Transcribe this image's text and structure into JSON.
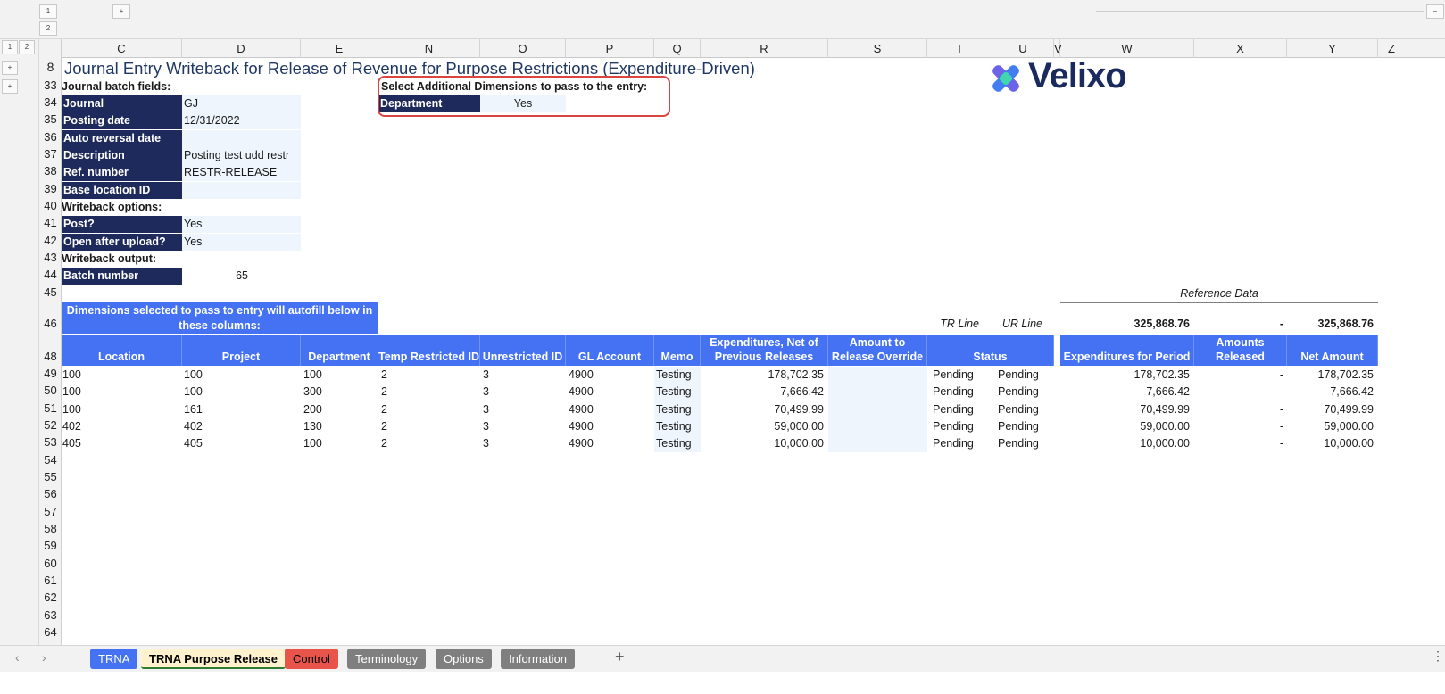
{
  "outline": {
    "levels_top": [
      "1",
      "2"
    ],
    "levels_side": [
      "1",
      "2"
    ],
    "expand": "+",
    "collapse": "−"
  },
  "columns": [
    "C",
    "D",
    "E",
    "N",
    "O",
    "P",
    "Q",
    "R",
    "S",
    "T",
    "U",
    "V",
    "W",
    "X",
    "Y",
    "Z"
  ],
  "rows": [
    "8",
    "33",
    "34",
    "35",
    "36",
    "37",
    "38",
    "39",
    "40",
    "41",
    "42",
    "43",
    "44",
    "45",
    "46",
    "48",
    "49",
    "50",
    "51",
    "52",
    "53",
    "54",
    "55",
    "56",
    "57",
    "58",
    "59",
    "60",
    "61",
    "62",
    "63",
    "64"
  ],
  "title": "Journal Entry Writeback for Release of Revenue for Purpose Restrictions (Expenditure-Driven)",
  "logo_text": "Velixo",
  "batch": {
    "header": "Journal batch fields:",
    "fields": [
      {
        "label": "Journal",
        "value": "GJ"
      },
      {
        "label": "Posting date",
        "value": "12/31/2022"
      },
      {
        "label": "Auto reversal date",
        "value": ""
      },
      {
        "label": "Description",
        "value": "Posting test udd restr"
      },
      {
        "label": "Ref. number",
        "value": "RESTR-RELEASE"
      },
      {
        "label": "Base location ID",
        "value": ""
      }
    ]
  },
  "writeback_options": {
    "header": "Writeback options:",
    "fields": [
      {
        "label": "Post?",
        "value": "Yes"
      },
      {
        "label": "Open after upload?",
        "value": "Yes"
      }
    ]
  },
  "writeback_output": {
    "header": "Writeback output:",
    "label": "Batch number",
    "value": "65"
  },
  "dimensions": {
    "header": "Select Additional Dimensions to pass to the entry:",
    "label": "Department",
    "value": "Yes"
  },
  "dim_note": "Dimensions selected to pass to entry will autofill below in these columns:",
  "reference_data": "Reference Data",
  "tr_line": "TR Line",
  "ur_line": "UR Line",
  "totals": {
    "expenditures": "325,868.76",
    "released": "-",
    "net": "325,868.76"
  },
  "table_headers": {
    "location": "Location",
    "project": "Project",
    "department": "Department",
    "temp_restricted": "Temp Restricted ID",
    "unrestricted": "Unrestricted ID",
    "gl_account": "GL Account",
    "memo": "Memo",
    "expenditures_net": "Expenditures, Net of Previous Releases",
    "override": "Amount to Release Override",
    "status": "Status",
    "exp_period": "Expenditures for Period",
    "amounts_released": "Amounts Released",
    "net_amount": "Net Amount"
  },
  "table_rows": [
    {
      "location": "100",
      "project": "100",
      "department": "100",
      "temp": "2",
      "unres": "3",
      "gl": "4900",
      "memo": "Testing",
      "exp_net": "178,702.35",
      "tr": "Pending",
      "ur": "Pending",
      "exp_period": "178,702.35",
      "released": "-",
      "net": "178,702.35"
    },
    {
      "location": "100",
      "project": "100",
      "department": "300",
      "temp": "2",
      "unres": "3",
      "gl": "4900",
      "memo": "Testing",
      "exp_net": "7,666.42",
      "tr": "Pending",
      "ur": "Pending",
      "exp_period": "7,666.42",
      "released": "-",
      "net": "7,666.42"
    },
    {
      "location": "100",
      "project": "161",
      "department": "200",
      "temp": "2",
      "unres": "3",
      "gl": "4900",
      "memo": "Testing",
      "exp_net": "70,499.99",
      "tr": "Pending",
      "ur": "Pending",
      "exp_period": "70,499.99",
      "released": "-",
      "net": "70,499.99"
    },
    {
      "location": "402",
      "project": "402",
      "department": "130",
      "temp": "2",
      "unres": "3",
      "gl": "4900",
      "memo": "Testing",
      "exp_net": "59,000.00",
      "tr": "Pending",
      "ur": "Pending",
      "exp_period": "59,000.00",
      "released": "-",
      "net": "59,000.00"
    },
    {
      "location": "405",
      "project": "405",
      "department": "100",
      "temp": "2",
      "unres": "3",
      "gl": "4900",
      "memo": "Testing",
      "exp_net": "10,000.00",
      "tr": "Pending",
      "ur": "Pending",
      "exp_period": "10,000.00",
      "released": "-",
      "net": "10,000.00"
    }
  ],
  "sheet_tabs": [
    {
      "label": "TRNA",
      "bg": "#4472f2",
      "fg": "#ffffff"
    },
    {
      "label": "TRNA Purpose Release",
      "bg": "#fff2cc",
      "fg": "#000000",
      "active": true
    },
    {
      "label": "Control",
      "bg": "#e8534a",
      "fg": "#000000"
    },
    {
      "label": "Terminology",
      "bg": "#7f7f7f",
      "fg": "#ffffff"
    },
    {
      "label": "Options",
      "bg": "#7f7f7f",
      "fg": "#ffffff"
    },
    {
      "label": "Information",
      "bg": "#7f7f7f",
      "fg": "#ffffff"
    }
  ],
  "add_sheet": "+",
  "more_options": "⋮",
  "nav_prev": "‹",
  "nav_next": "›",
  "colors": {
    "navy": "#1f2a5c",
    "blue_header": "#4472f2",
    "input_fill": "#eef5fd",
    "highlight_red": "#d9463f"
  }
}
